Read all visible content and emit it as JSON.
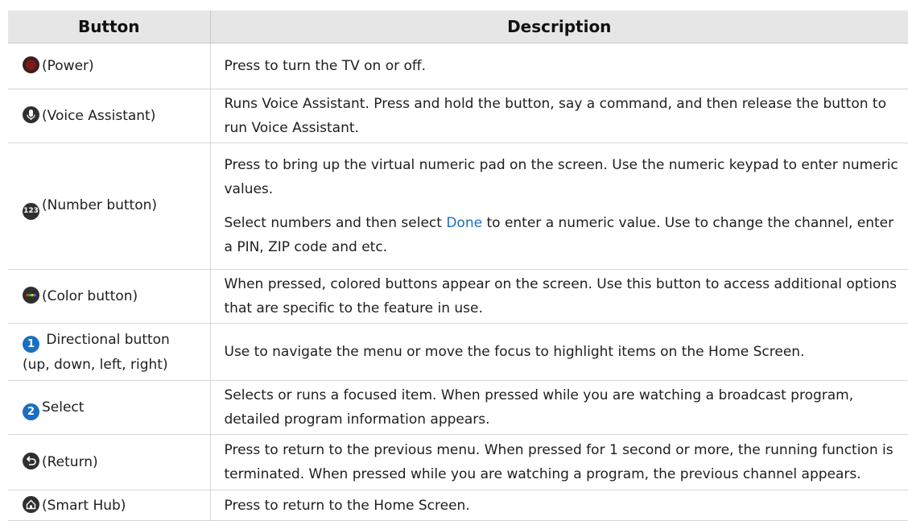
{
  "header": {
    "button": "Button",
    "description": "Description"
  },
  "rows": [
    {
      "icon": "power-icon",
      "label": "(Power)",
      "desc": "Press to turn the TV on or off."
    },
    {
      "icon": "microphone-icon",
      "label": "(Voice Assistant)",
      "desc": "Runs Voice Assistant. Press and hold the button, say a command, and then release the button to run Voice Assistant."
    },
    {
      "icon": "number-123-icon",
      "icon_text": "123",
      "label": "(Number button)",
      "desc1": "Press to bring up the virtual numeric pad on the screen. Use the numeric keypad to enter numeric values.",
      "desc2_pre": "Select numbers and then select ",
      "desc2_link": "Done",
      "desc2_post": " to enter a numeric value. Use to change the channel, enter a PIN, ZIP code and etc."
    },
    {
      "icon": "color-button-icon",
      "label": "(Color button)",
      "desc": "When pressed, colored buttons appear on the screen. Use this button to access additional options that are specific to the feature in use."
    },
    {
      "icon": "number-1-icon",
      "icon_text": "1",
      "label_line1": "Directional button",
      "label_line2": "(up, down, left, right)",
      "desc": "Use to navigate the menu or move the focus to highlight items on the Home Screen."
    },
    {
      "icon": "number-2-icon",
      "icon_text": "2",
      "label": "Select",
      "desc": "Selects or runs a focused item. When pressed while you are watching a broadcast program, detailed program information appears."
    },
    {
      "icon": "return-icon",
      "label": "(Return)",
      "desc": "Press to return to the previous menu. When pressed for 1 second or more, the running function is terminated. When pressed while you are watching a program, the previous channel appears."
    },
    {
      "icon": "home-icon",
      "label": "(Smart Hub)",
      "desc": "Press to return to the Home Screen."
    }
  ],
  "colors": {
    "header_bg": "#e6e6e6",
    "link": "#1b6fc0",
    "badge_blue": "#1b6fc0",
    "icon_dark": "#2f2f2f"
  }
}
